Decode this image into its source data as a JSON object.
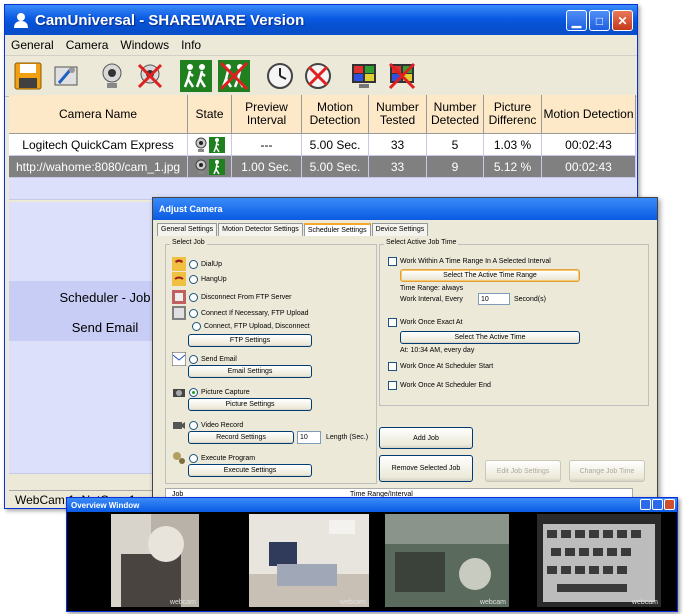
{
  "main_window": {
    "title": "CamUniversal - SHAREWARE Version",
    "menu": [
      "General",
      "Camera",
      "Windows",
      "Info"
    ],
    "toolbar_icons": [
      "floppy-disk-icon",
      "settings-tools-icon",
      "webcam-icon",
      "webcam-disabled-icon",
      "walking-man-icon",
      "walking-man-disabled-icon",
      "clock-icon",
      "clock-disabled-icon",
      "monitor-icon",
      "monitor-disabled-icon"
    ],
    "table": {
      "headers": [
        "Camera Name",
        "State",
        "Preview Interval",
        "Motion Detection",
        "Number Tested",
        "Number Detected",
        "Picture Differenc",
        "Motion Detection"
      ],
      "rows": [
        [
          "Logitech QuickCam Express",
          "",
          "---",
          "5.00 Sec.",
          "33",
          "5",
          "1.03 %",
          "00:02:43"
        ],
        [
          "http://wahome:8080/cam_1.jpg",
          "",
          "1.00 Sec.",
          "5.00 Sec.",
          "33",
          "9",
          "5.12 %",
          "00:02:43"
        ]
      ]
    },
    "side_labels": [
      "Scheduler - Job",
      "Send Email"
    ],
    "status_text": "WebCam:1, NetCam:1",
    "colors": {
      "header_bg": "#fde8c8",
      "selected_row": "#808080",
      "empty_row": "#dce0fa",
      "title_blue": "#0a5ae3"
    }
  },
  "dialog": {
    "title": "Adjust Camera",
    "tabs": [
      "General Settings",
      "Motion Detector Settings",
      "Scheduler Settings",
      "Device Settings"
    ],
    "active_tab": "Scheduler Settings",
    "select_job": {
      "title": "Select Job",
      "options": [
        "DialUp",
        "HangUp",
        "Disconnect From FTP Server",
        "Connect If Necessary, FTP Upload",
        "Connect, FTP Upload, Disconnect",
        "Send Email",
        "Picture Capture",
        "Video Record",
        "Execute Program"
      ],
      "selected": "Picture Capture",
      "buttons": [
        "FTP Settings",
        "Email Settings",
        "Picture Settings",
        "Record Settings",
        "Execute Settings"
      ],
      "length_value": "10",
      "length_label": "Length (Sec.)"
    },
    "active_time": {
      "title": "Select Active Job Time",
      "check1": "Work Within A Time Range In A Selected Interval",
      "btn_time_range": "Select The Active Time Range",
      "time_range_text": "Time Range: always",
      "interval_label": "Work Interval, Every",
      "interval_value": "10",
      "interval_unit": "Second(s)",
      "check2": "Work Once Exact At",
      "btn_active_time": "Select The Active Time",
      "at_text": "At: 10:34 AM, every day",
      "check3": "Work Once At Scheduler Start",
      "check4": "Work Once At Scheduler End"
    },
    "buttons": {
      "add_job": "Add Job",
      "remove_job": "Remove Selected Job",
      "edit_job": "Edit Job Settings",
      "change_time": "Change Job Time"
    },
    "job_list_headers": [
      "Job",
      "Time Range/Interval"
    ]
  },
  "overview": {
    "title": "Overview Window",
    "feed_labels": [
      "webcam",
      "webcam",
      "webcam",
      "webcam"
    ]
  }
}
